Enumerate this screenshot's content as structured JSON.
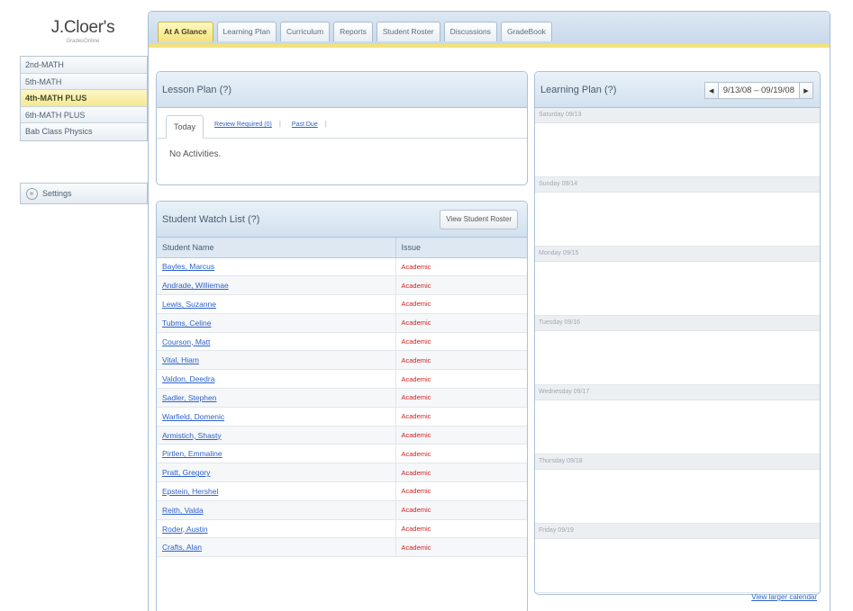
{
  "brand": {
    "title": "J.Cloer's",
    "subtitle": "GradesOnline"
  },
  "classes": [
    {
      "label": "2nd-MATH"
    },
    {
      "label": "5th-MATH"
    },
    {
      "label": "4th-MATH PLUS",
      "active": true
    },
    {
      "label": "6th-MATH PLUS"
    },
    {
      "label": "Bab Class Physics"
    }
  ],
  "settings_label": "Settings",
  "tabs": [
    {
      "label": "At A Glance",
      "active": true
    },
    {
      "label": "Learning Plan"
    },
    {
      "label": "Curriculum"
    },
    {
      "label": "Reports"
    },
    {
      "label": "Student Roster"
    },
    {
      "label": "Discussions"
    },
    {
      "label": "GradeBook"
    }
  ],
  "lesson_plan": {
    "title": "Lesson Plan (?)",
    "tab_today": "Today",
    "link_review": "Review Required (0)",
    "link_pastdue": "Past Due",
    "empty_text": "No Activities."
  },
  "watch_list": {
    "title": "Student Watch List (?)",
    "button": "View Student Roster",
    "col_name": "Student Name",
    "col_issue": "Issue",
    "rows": [
      {
        "name": "Bayles, Marcus",
        "issue": "Academic"
      },
      {
        "name": "Andrade, Williemae",
        "issue": "Academic"
      },
      {
        "name": "Lewis, Suzanne",
        "issue": "Academic"
      },
      {
        "name": "Tubms, Celine",
        "issue": "Academic"
      },
      {
        "name": "Courson, Matt",
        "issue": "Academic"
      },
      {
        "name": "Vital, Hiam",
        "issue": "Academic"
      },
      {
        "name": "Valdon, Deedra",
        "issue": "Academic"
      },
      {
        "name": "Sadler, Stephen",
        "issue": "Academic"
      },
      {
        "name": "Warfield, Domenic",
        "issue": "Academic"
      },
      {
        "name": "Armistich, Shasty",
        "issue": "Academic"
      },
      {
        "name": "Pirtlen, Emmaline",
        "issue": "Academic"
      },
      {
        "name": "Pratt, Gregory",
        "issue": "Academic"
      },
      {
        "name": "Epstein, Hershel",
        "issue": "Academic"
      },
      {
        "name": "Reith, Valda",
        "issue": "Academic"
      },
      {
        "name": "Roder, Austin",
        "issue": "Academic"
      },
      {
        "name": "Crafts, Alan",
        "issue": "Academic"
      }
    ]
  },
  "learning_plan": {
    "title": "Learning Plan (?)",
    "date_range": "9/13/08 – 09/19/08",
    "days": [
      {
        "label": "Saturday 09/13"
      },
      {
        "label": "Sunday 09/14"
      },
      {
        "label": "Monday 09/15"
      },
      {
        "label": "Tuesday 09/16"
      },
      {
        "label": "Wednesday 09/17"
      },
      {
        "label": "Thursday 09/18"
      },
      {
        "label": "Friday 09/19"
      }
    ],
    "larger_link": "View larger calendar"
  }
}
